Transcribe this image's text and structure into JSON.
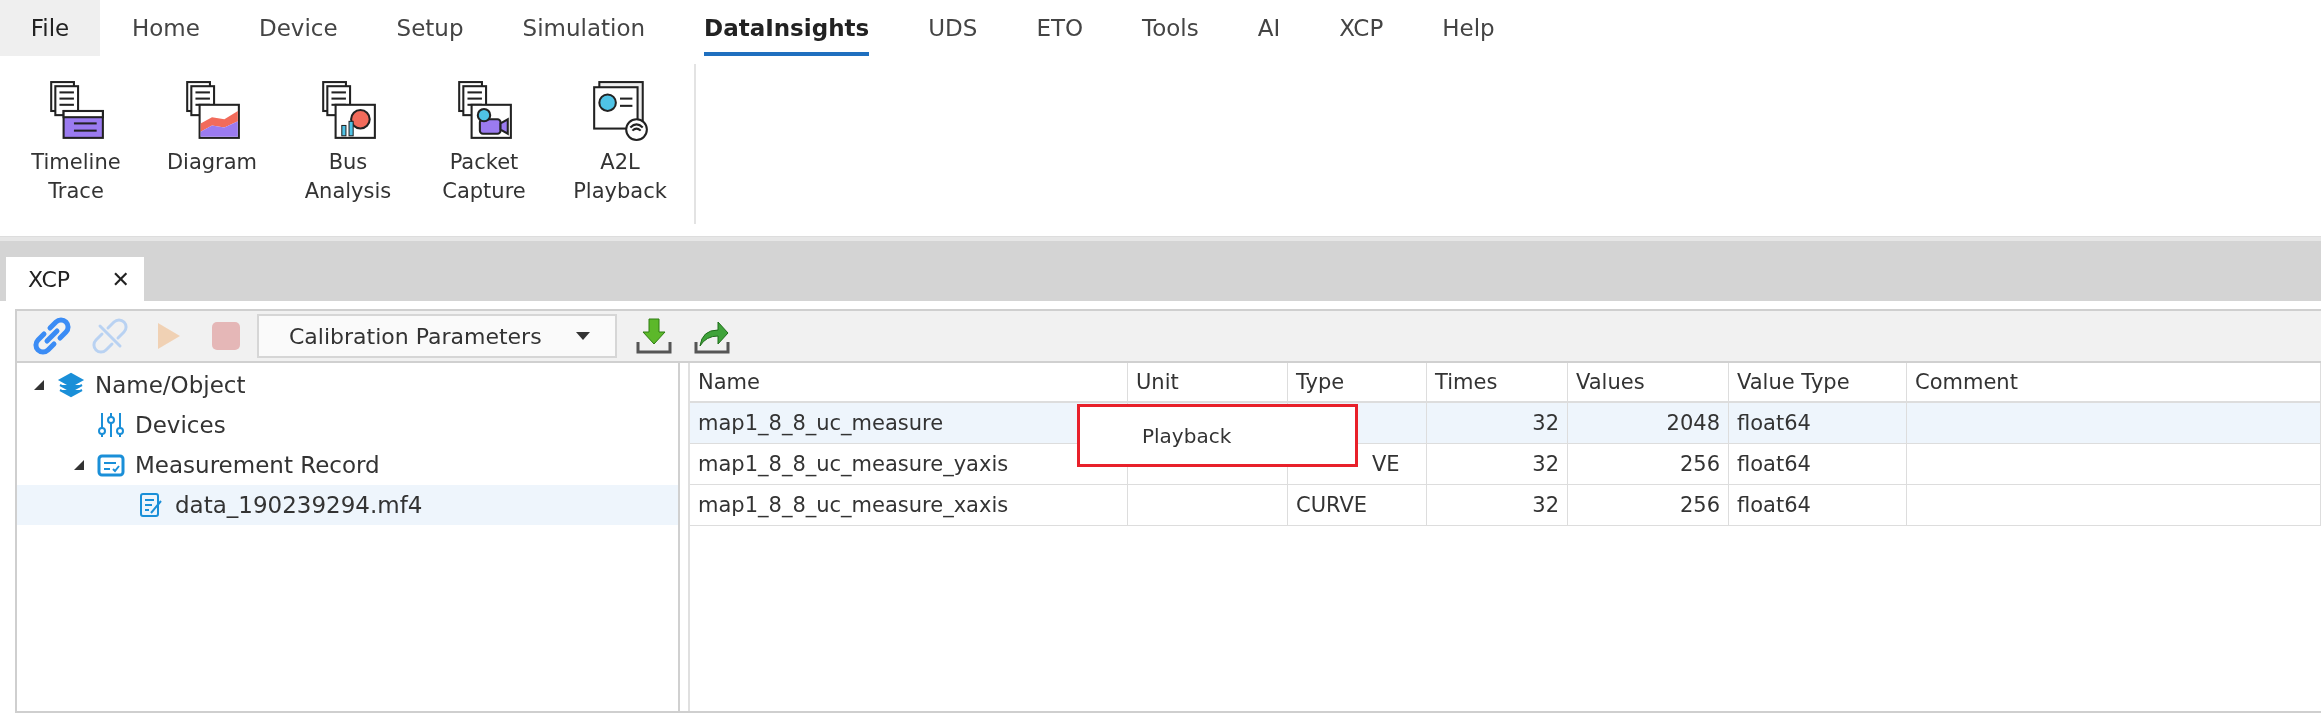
{
  "menu_bar": {
    "items": [
      {
        "label": "File",
        "kind": "file",
        "selected": false
      },
      {
        "label": "Home",
        "kind": "tab",
        "selected": false
      },
      {
        "label": "Device",
        "kind": "tab",
        "selected": false
      },
      {
        "label": "Setup",
        "kind": "tab",
        "selected": false
      },
      {
        "label": "Simulation",
        "kind": "tab",
        "selected": false
      },
      {
        "label": "DataInsights",
        "kind": "tab",
        "selected": true
      },
      {
        "label": "UDS",
        "kind": "tab",
        "selected": false
      },
      {
        "label": "ETO",
        "kind": "tab",
        "selected": false
      },
      {
        "label": "Tools",
        "kind": "tab",
        "selected": false
      },
      {
        "label": "AI",
        "kind": "tab",
        "selected": false
      },
      {
        "label": "XCP",
        "kind": "tab",
        "selected": false
      },
      {
        "label": "Help",
        "kind": "tab",
        "selected": false
      }
    ]
  },
  "ribbon": {
    "buttons": [
      {
        "label": "Timeline\nTrace",
        "kind": "timeline"
      },
      {
        "label": "Diagram",
        "kind": "diagram"
      },
      {
        "label": "Bus\nAnalysis",
        "kind": "bus"
      },
      {
        "label": "Packet\nCapture",
        "kind": "packet"
      },
      {
        "label": "A2L\nPlayback",
        "kind": "playback"
      }
    ]
  },
  "document_tabs": [
    {
      "label": "XCP",
      "close": "✕",
      "selected": true
    }
  ],
  "toolbar": {
    "buttons": [
      {
        "kind": "connect",
        "disabled": false
      },
      {
        "kind": "disconnect",
        "disabled": true
      },
      {
        "kind": "play",
        "disabled": true
      },
      {
        "kind": "stop",
        "disabled": true
      }
    ],
    "dropdown": {
      "value": "Calibration Parameters"
    },
    "actions": [
      {
        "kind": "download"
      },
      {
        "kind": "export"
      }
    ]
  },
  "tree": [
    {
      "label": "Name/Object",
      "kind": "layers",
      "expanded": true,
      "selected": false,
      "children": [
        {
          "label": "Devices",
          "kind": "sliders",
          "selected": false
        },
        {
          "label": "Measurement Record",
          "kind": "record",
          "expanded": true,
          "selected": false,
          "children": [
            {
              "label": "data_190239294.mf4",
              "kind": "file",
              "selected": true
            }
          ]
        }
      ]
    }
  ],
  "table": {
    "columns": [
      "Name",
      "Unit",
      "Type",
      "Times",
      "Values",
      "Value Type",
      "Comment"
    ],
    "rows": [
      {
        "selected": true,
        "cells": [
          "map1_8_8_uc_measure",
          "",
          "",
          "32",
          "2048",
          "float64",
          ""
        ]
      },
      {
        "selected": false,
        "cells": [
          "map1_8_8_uc_measure_yaxis",
          "",
          "VE",
          "32",
          "256",
          "float64",
          ""
        ]
      },
      {
        "selected": false,
        "cells": [
          "map1_8_8_uc_measure_xaxis",
          "",
          "CURVE",
          "32",
          "256",
          "float64",
          ""
        ]
      }
    ]
  },
  "context_menu": {
    "items": [
      "Playback"
    ]
  }
}
